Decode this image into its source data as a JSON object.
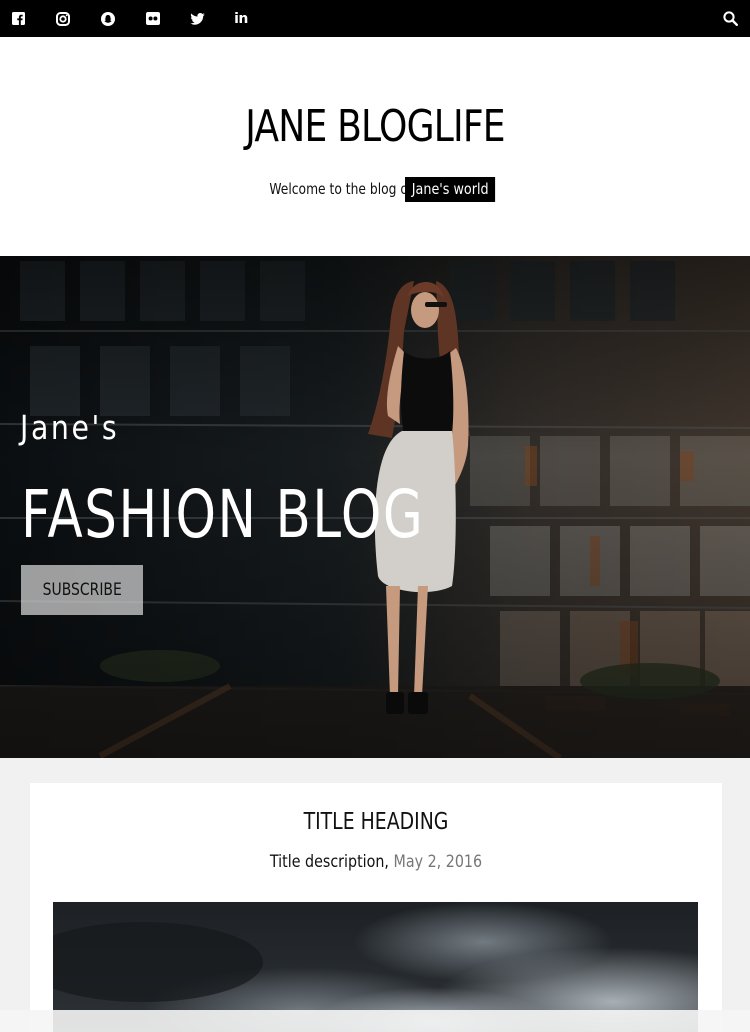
{
  "topbar": {
    "social_icons": [
      "facebook-icon",
      "instagram-icon",
      "snapchat-icon",
      "flickr-icon",
      "twitter-icon",
      "linkedin-icon"
    ],
    "search_icon": "search-icon",
    "linkedin_text": "in"
  },
  "header": {
    "site_title": "JANE BLOGLIFE",
    "tagline_prefix": "Welcome to the blog of",
    "tagline_highlight": "Jane's world"
  },
  "hero": {
    "kicker": "Jane's",
    "title": "FASHION BLOG",
    "button_label": "SUBSCRIBE"
  },
  "post": {
    "title": "TITLE HEADING",
    "description": "Title description,",
    "date": "May 2, 2016"
  },
  "colors": {
    "topbar": "#000000",
    "page_bg": "#f1f1f1",
    "card_bg": "#ffffff",
    "date_text": "#777777"
  }
}
